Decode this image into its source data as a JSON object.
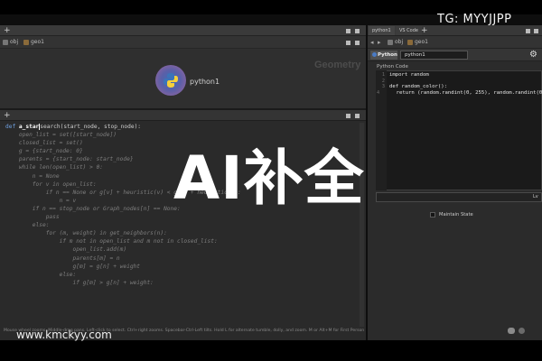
{
  "overlay": {
    "channel": "TG: MYYJJPP",
    "title": "AI补全",
    "site": "www.kmckyy.com"
  },
  "network": {
    "tab_add": "+",
    "path": [
      "obj",
      "geo1"
    ],
    "context_label": "Geometry",
    "node_label": "python1"
  },
  "code_panel": {
    "tab_add": "+",
    "first_line": {
      "keyword": "def",
      "name": "a_star",
      "rest": "search(start_node, stop_node):"
    },
    "lines": [
      "    open_list = set([start_node])",
      "    closed_list = set()",
      "    g = {start_node: 0}",
      "    parents = {start_node: start_node}",
      "    while len(open_list) > 0:",
      "        n = None",
      "        for v in open_list:",
      "            if n == None or g[v] + heuristic(v) < g[n] + heuristic(n):",
      "                n = v",
      "        if n == stop_node or Graph_nodes[n] == None:",
      "            pass",
      "        else:",
      "            for (m, weight) in get_neighbors(n):",
      "                if m not in open_list and m not in closed_list:",
      "                    open_list.add(m)",
      "                    parents[m] = n",
      "                    g[m] = g[n] + weight",
      "                else:",
      "                    if g[m] > g[n] + weight:"
    ],
    "status": "Mouse wheel zooms. Middle-drag pans. Left-click to select. Ctrl+right zooms. Spacebar-Ctrl-Left tilts. Hold L for alternate tumble, dolly, and zoom. M or Alt+M for First Person Navigation."
  },
  "python_panel": {
    "tabs": [
      "python1",
      "VS Code"
    ],
    "tab_add": "+",
    "path": [
      "obj",
      "geo1"
    ],
    "type_tab": "Python",
    "node_name": "python1",
    "section_label": "Python Code",
    "editor_lines": [
      {
        "n": "1",
        "text": "import random"
      },
      {
        "n": "2",
        "text": ""
      },
      {
        "n": "3",
        "text": "def random_color():"
      },
      {
        "n": "4",
        "text": "    return (random.randint(0, 255), random.randint(0, 2"
      }
    ],
    "apply_label": "Lv",
    "maintain_state_label": "Maintain State"
  },
  "icons": [
    "plus-icon",
    "python-logo-icon",
    "gear-icon",
    "node-icon",
    "checkbox-icon"
  ]
}
